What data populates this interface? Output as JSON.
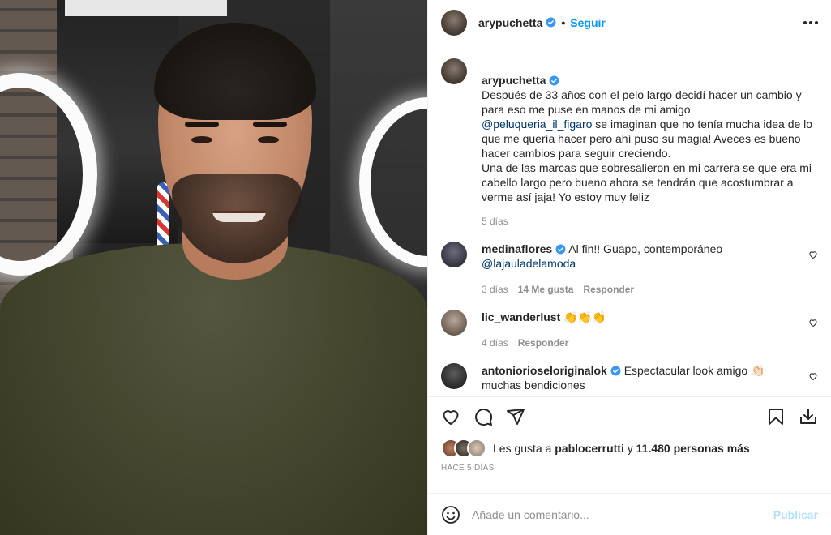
{
  "post": {
    "author": "arypuchetta",
    "follow_label": "Seguir",
    "caption": "Después de 33 años con el pelo largo decidí hacer un cambio y para eso me puse en manos de mi amigo",
    "caption_mention": "@peluqueria_il_figaro",
    "caption_rest": " se imaginan que no tenía mucha idea de lo que me quería hacer pero ahí puso su magia! Aveces es bueno hacer cambios para seguir creciendo.\nUna de las marcas que sobresalieron en mi carrera se que era mi cabello largo pero bueno ahora se tendrán que acostumbrar a verme así jaja! Yo estoy muy feliz",
    "caption_time": "5 días"
  },
  "comments": [
    {
      "user": "medinaflores",
      "verified": true,
      "text": "Al fin!! Guapo, contemporáneo",
      "mention": "@lajauladelamoda",
      "time": "3 días",
      "likes": "14 Me gusta",
      "reply": "Responder"
    },
    {
      "user": "lic_wanderlust",
      "verified": false,
      "text": "👏👏👏",
      "time": "4 días",
      "reply": "Responder"
    },
    {
      "user": "antoniorioseloriginalok",
      "verified": true,
      "text": "Espectacular look amigo 👏🏻",
      "text2": "muchas bendiciones"
    }
  ],
  "likes": {
    "prefix": "Les gusta a",
    "user": "pablocerrutti",
    "joiner": "y",
    "others": "11.480 personas más"
  },
  "ago": "HACE 5 DÍAS",
  "add_comment": {
    "placeholder": "Añade un comentario...",
    "publish": "Publicar"
  },
  "colors": {
    "accent": "#0095f6",
    "verified": "#3897f0",
    "muted": "#8e8e8e",
    "mention": "#00376b"
  }
}
